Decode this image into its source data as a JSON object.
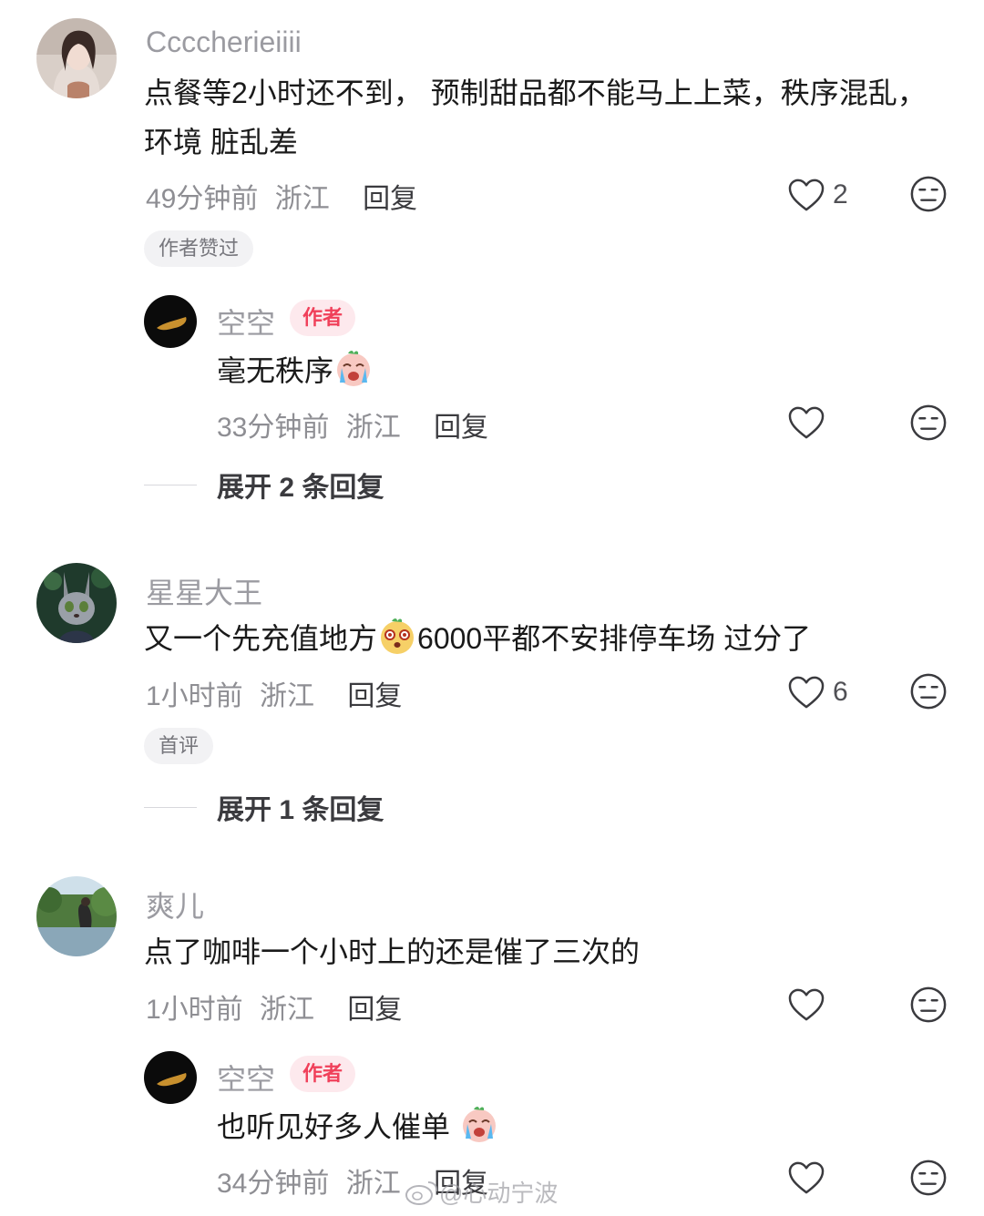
{
  "comments": [
    {
      "username": "Ccccherieiiii",
      "text": "点餐等2小时还不到， 预制甜品都不能马上上菜，秩序混乱，环境 脏乱差",
      "time": "49分钟前",
      "location": "浙江",
      "reply_label": "回复",
      "likes": "2",
      "tag": "作者赞过",
      "reply": {
        "username": "空空",
        "badge": "作者",
        "text": "毫无秩序",
        "emoji": "crying-face-emoji",
        "time": "33分钟前",
        "location": "浙江",
        "reply_label": "回复"
      },
      "expand_label": "展开 2 条回复"
    },
    {
      "username": "星星大王",
      "text_before": "又一个先充值地方",
      "emoji": "shocked-face-emoji",
      "text_after": "6000平都不安排停车场 过分了",
      "time": "1小时前",
      "location": "浙江",
      "reply_label": "回复",
      "likes": "6",
      "tag": "首评",
      "expand_label": "展开 1 条回复"
    },
    {
      "username": "爽儿",
      "text": "点了咖啡一个小时上的还是催了三次的",
      "time": "1小时前",
      "location": "浙江",
      "reply_label": "回复",
      "reply": {
        "username": "空空",
        "badge": "作者",
        "text": "也听见好多人催单",
        "emoji": "crying-face-emoji",
        "time": "34分钟前",
        "location": "浙江",
        "reply_label": "回复"
      }
    }
  ],
  "watermark": "@心动宁波",
  "colors": {
    "author_badge": "#f0405a",
    "username": "#9b9ba1",
    "text": "#1a1a1a"
  },
  "icons": [
    "heart-outline-icon",
    "meh-face-icon",
    "weibo-logo-icon"
  ]
}
